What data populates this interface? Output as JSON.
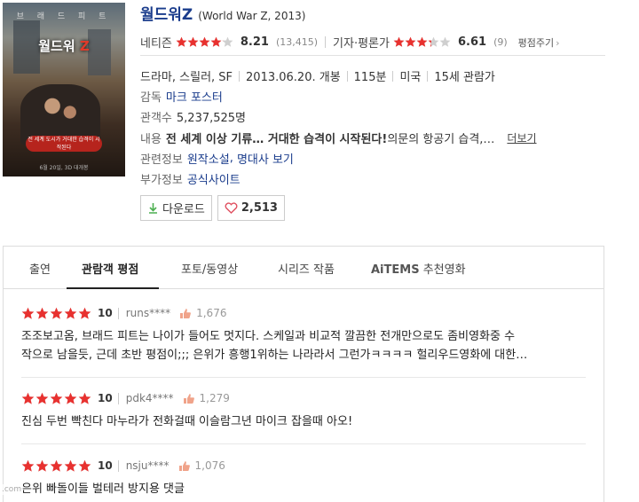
{
  "poster": {
    "top_text": "브 래 드 피 트",
    "title_main": "월드워",
    "title_z": "Z",
    "tagline": "전 세계 도시가 거대한 습격이 시작된다",
    "date": "6월 20일, 3D 대개봉"
  },
  "movie": {
    "title": "월드워Z",
    "subtitle": "(World War Z, 2013)"
  },
  "ratings": {
    "netizen_label": "네티즌",
    "netizen_score": "8.21",
    "netizen_stars": 4.1,
    "netizen_count": "(13,415)",
    "critic_label": "기자·평론가",
    "critic_score": "6.61",
    "critic_stars": 3.3,
    "critic_count": "(9)",
    "rate_button": "평점주기"
  },
  "info": {
    "genre": "드라마, 스릴러, SF",
    "release": "2013.06.20. 개봉",
    "runtime": "115분",
    "country": "미국",
    "age": "15세 관람가",
    "director_label": "감독",
    "director": "마크 포스터",
    "audience_label": "관객수",
    "audience": "5,237,525명",
    "content_label": "내용",
    "content_bold": "전 세계 이상 기류… 거대한 습격이 시작된다!",
    "content_rest": " 의문의 항공기 습격,…",
    "more": "더보기",
    "related_label": "관련정보",
    "related_1": "원작소설",
    "related_2": "명대사 보기",
    "extra_label": "부가정보",
    "extra_1": "공식사이트"
  },
  "actions": {
    "download": "다운로드",
    "likes": "2,513"
  },
  "tabs": {
    "cast": "출연",
    "reviews": "관람객 평점",
    "photo": "포토/동영상",
    "series": "시리즈 작품",
    "aitems": "AiTEMS",
    "aitems_suffix": " 추천영화"
  },
  "reviews": [
    {
      "score": "10",
      "user": "runs****",
      "likes": "1,676",
      "line1": "조조보고옴, 브래드 피트는 나이가 들어도 멋지다. 스케일과 비교적 깔끔한 전개만으로도 좀비영화중 수",
      "line2": "작으로 남을듯, 근데 초반 평점이;;; 은위가 흥행1위하는 나라라서 그런가ㅋㅋㅋㅋ 헐리우드영화에 대한…"
    },
    {
      "score": "10",
      "user": "pdk4****",
      "likes": "1,279",
      "line1": "진심 두번 빡친다 마누라가 전화걸때 이슬람그년 마이크 잡을때 아오!",
      "line2": ""
    },
    {
      "score": "10",
      "user": "nsju****",
      "likes": "1,076",
      "line1": "은위 빠돌이들 벌테러 방지용 댓글",
      "line2": ""
    }
  ],
  "watermark": ".com",
  "colors": {
    "star": "#e8312f",
    "star_empty": "#cfcfcf",
    "link": "#1a3c8c",
    "download_icon": "#4caf50",
    "heart": "#e05060",
    "thumb": "#f0a38a"
  }
}
